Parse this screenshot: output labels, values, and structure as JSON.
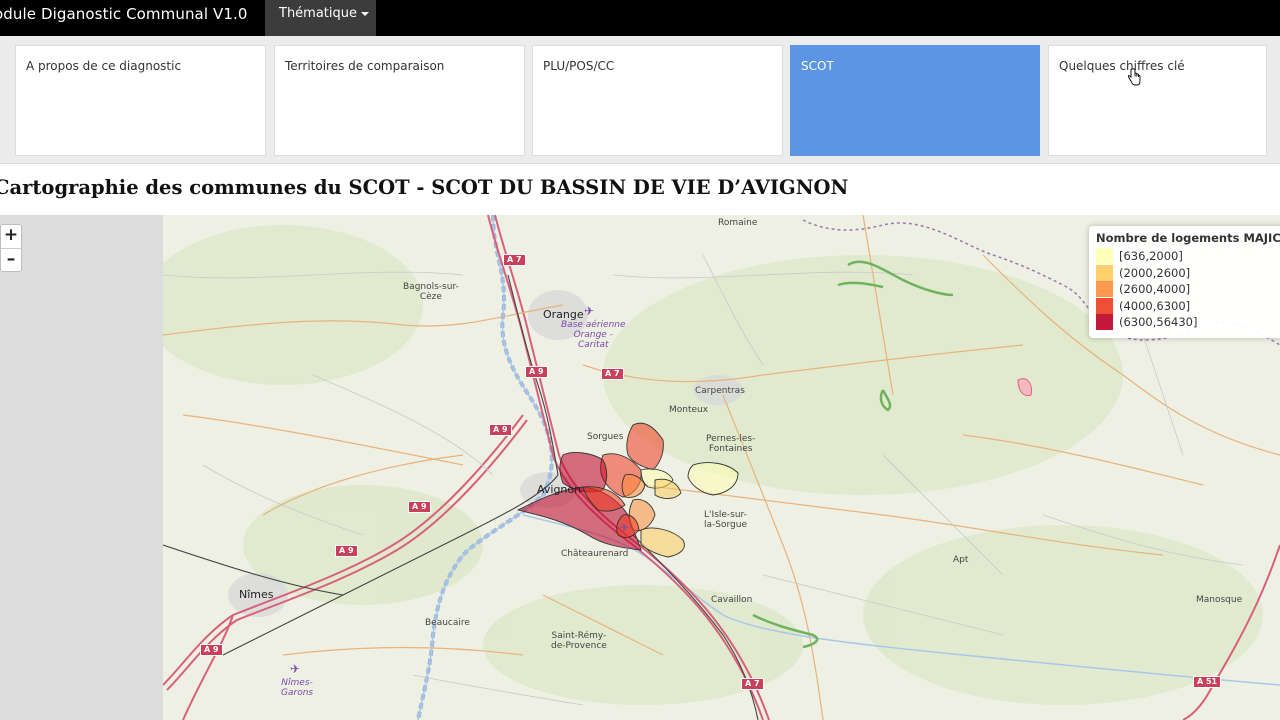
{
  "navbar": {
    "brand": "odule Diganostic Communal V1.0",
    "dropdown_label": "Thématique"
  },
  "tabs": [
    {
      "label": "A propos de ce diagnostic",
      "active": false
    },
    {
      "label": "Territoires de comparaison",
      "active": false
    },
    {
      "label": "PLU/POS/CC",
      "active": false
    },
    {
      "label": "SCOT",
      "active": true
    },
    {
      "label": "Quelques chiffres clé",
      "active": false
    }
  ],
  "page_title": "Cartographie des communes du SCOT - SCOT DU BASSIN DE VIE D’AVIGNON",
  "map": {
    "zoom_in": "+",
    "zoom_out": "–",
    "legend": {
      "title": "Nombre de logements MAJIC",
      "items": [
        {
          "label": "[636,2000]",
          "color": "#ffffb2"
        },
        {
          "label": "(2000,2600]",
          "color": "#fecc5c"
        },
        {
          "label": "(2600,4000]",
          "color": "#fd8d3c"
        },
        {
          "label": "(4000,6300]",
          "color": "#f03b20"
        },
        {
          "label": "(6300,56430]",
          "color": "#bd0026"
        }
      ]
    },
    "places": {
      "romaine": "Romaine",
      "bagnols": "Bagnols-sur-\nCèze",
      "orange": "Orange",
      "base_aerienne": "Base aérienne\nOrange -\nCaritat",
      "carpentras": "Carpentras",
      "monteux": "Monteux",
      "sorgues": "Sorgues",
      "pernes": "Pernes-les-\nFontaines",
      "avignon": "Avignon",
      "isle": "L'Isle-sur-\nla-Sorgue",
      "chateaurenard": "Châteaurenard",
      "nimes": "Nîmes",
      "beaucaire": "Beaucaire",
      "saint_remy": "Saint-Rémy-\nde-Provence",
      "cavaillon": "Cavaillon",
      "apt": "Apt",
      "manosque": "Manosque",
      "nimes_garons": "Nîmes-\nGarons"
    },
    "roads": {
      "a7_top": "A 7",
      "a9_1": "A 9",
      "a7_2": "A 7",
      "a9_2": "A 9",
      "a9_3": "A 9",
      "a9_4": "A 9",
      "a9_5": "A 9",
      "a7_bottom": "A 7",
      "a51": "A 51"
    }
  }
}
